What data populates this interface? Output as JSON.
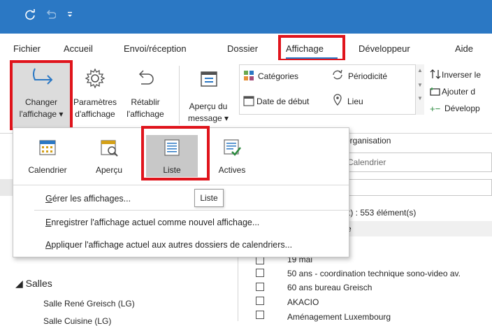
{
  "titlebar": {
    "sync_icon": "sync-icon",
    "undo_icon": "undo-icon",
    "more_icon": "customize-arrow-icon"
  },
  "tabs": [
    {
      "label": "Fichier"
    },
    {
      "label": "Accueil"
    },
    {
      "label": "Envoi/réception"
    },
    {
      "label": "Dossier"
    },
    {
      "label": "Affichage"
    },
    {
      "label": "Développeur"
    },
    {
      "label": "Aide"
    }
  ],
  "ribbon": {
    "change_view": {
      "line1": "Changer",
      "line2": "l'affichage ▾"
    },
    "view_settings": {
      "line1": "Paramètres",
      "line2": "d'affichage"
    },
    "reset_view": {
      "line1": "Rétablir",
      "line2": "l'affichage"
    },
    "preview": {
      "line1": "Aperçu du",
      "line2": "message ▾"
    },
    "categories": "Catégories",
    "start_date": "Date de début",
    "recurrence": "Périodicité",
    "location": "Lieu",
    "reverse": "Inverser le",
    "add_column": "Ajouter d",
    "expand": "Développ",
    "group_label": "organisation"
  },
  "background": {
    "search_placeholder": "Calendrier",
    "count_text": "t) : 553 élément(s)",
    "col_header": "e",
    "salles_header": "◢ Salles",
    "salles_items": [
      "Salle René Greisch (LG)",
      "Salle Cuisine (LG)"
    ],
    "list_items": [
      "19 mai",
      "50 ans - coordination technique sono-video av.",
      "60 ans bureau Greisch",
      "AKACIO",
      "Aménagement Luxembourg"
    ]
  },
  "menu": {
    "views": [
      {
        "label": "Calendrier",
        "icon": "calendar-view-icon"
      },
      {
        "label": "Aperçu",
        "icon": "preview-view-icon"
      },
      {
        "label": "Liste",
        "icon": "list-view-icon"
      },
      {
        "label": "Actives",
        "icon": "active-view-icon"
      }
    ],
    "items": [
      {
        "pre": "",
        "ul": "G",
        "post": "érer les affichages..."
      },
      {
        "pre": "",
        "ul": "E",
        "post": "nregistrer l'affichage actuel comme nouvel affichage..."
      },
      {
        "pre": "",
        "ul": "A",
        "post": "ppliquer l'affichage actuel aux autres dossiers de calendriers..."
      }
    ],
    "tooltip": "Liste"
  },
  "colors": {
    "accent": "#2b78c4",
    "highlight": "#e0141c",
    "selected": "#c8c8c8"
  }
}
